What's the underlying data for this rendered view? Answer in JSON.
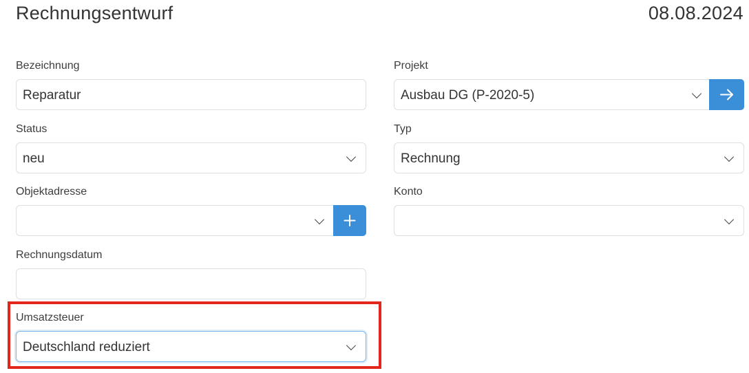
{
  "header": {
    "title": "Rechnungsentwurf",
    "date": "08.08.2024"
  },
  "form": {
    "bezeichnung": {
      "label": "Bezeichnung",
      "value": "Reparatur"
    },
    "projekt": {
      "label": "Projekt",
      "value": "Ausbau DG (P-2020-5)",
      "button_icon": "arrow-right-icon"
    },
    "status": {
      "label": "Status",
      "value": "neu"
    },
    "typ": {
      "label": "Typ",
      "value": "Rechnung"
    },
    "objektadresse": {
      "label": "Objektadresse",
      "value": "",
      "button_icon": "plus-icon"
    },
    "konto": {
      "label": "Konto",
      "value": ""
    },
    "rechnungsdatum": {
      "label": "Rechnungsdatum",
      "value": ""
    },
    "umsatzsteuer": {
      "label": "Umsatzsteuer",
      "value": "Deutschland reduziert"
    }
  },
  "colors": {
    "accent": "#3b8fd9",
    "highlight": "#e3261c"
  }
}
